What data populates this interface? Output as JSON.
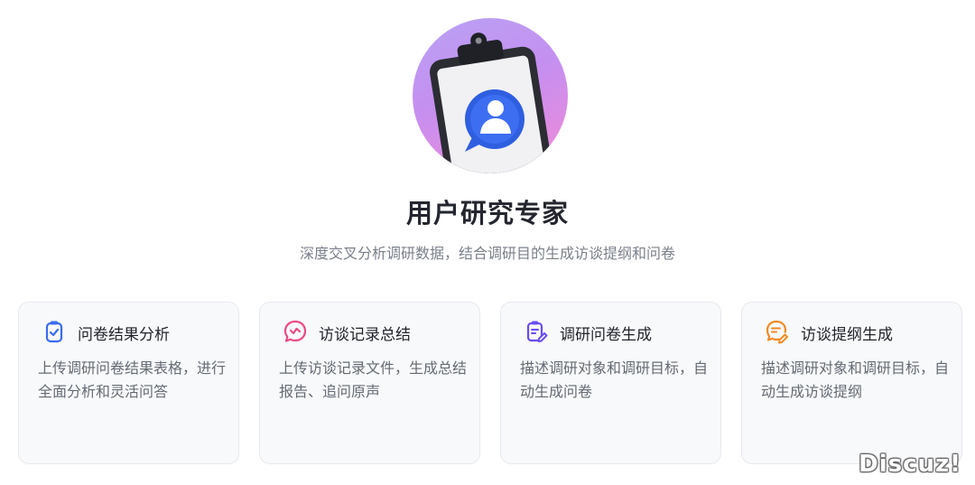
{
  "header": {
    "title": "用户研究专家",
    "subtitle": "深度交叉分析调研数据，结合调研目的生成访谈提纲和问卷",
    "avatar_icon": "clipboard-user-icon"
  },
  "cards": [
    {
      "title": "问卷结果分析",
      "description": "上传调研问卷结果表格，进行全面分析和灵活问答",
      "icon": "survey-analysis-icon",
      "icon_color": "#3a6cf0"
    },
    {
      "title": "访谈记录总结",
      "description": "上传访谈记录文件，生成总结报告、追问原声",
      "icon": "chat-bubble-icon",
      "icon_color": "#e94a86"
    },
    {
      "title": "调研问卷生成",
      "description": "描述调研对象和调研目标，自动生成问卷",
      "icon": "questionnaire-edit-icon",
      "icon_color": "#6a4cf0"
    },
    {
      "title": "访谈提纲生成",
      "description": "描述调研对象和调研目标，自动生成访谈提纲",
      "icon": "outline-edit-icon",
      "icon_color": "#f08a24"
    }
  ],
  "watermark": "Discuz!"
}
